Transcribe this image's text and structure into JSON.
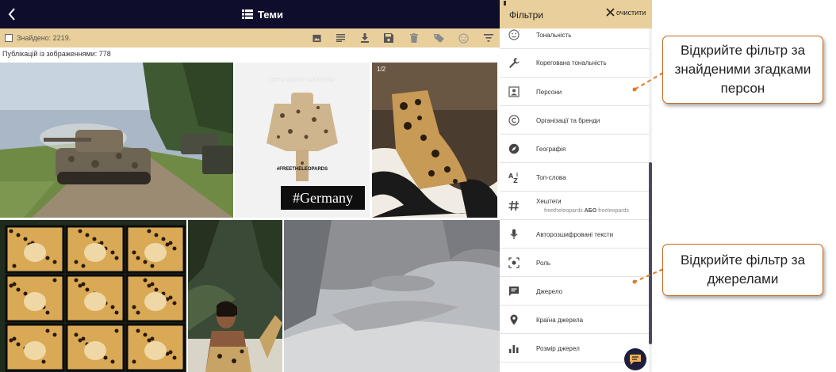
{
  "topbar": {
    "back_icon": "chevron-left-icon",
    "title_icon": "list-icon",
    "title": "Теми"
  },
  "toolbar": {
    "found_label": "Знайдено: 2219.",
    "icons": [
      "image-icon",
      "text-lines-icon",
      "download-icon",
      "save-icon",
      "trash-icon",
      "tag-icon",
      "emoji-icon",
      "filter-icon"
    ]
  },
  "publications_label": "Публікацій із зображеннями: 778",
  "tiles": [
    {
      "name": "tile-tank",
      "badge": ""
    },
    {
      "name": "tile-leopards-poster",
      "caption": "LET'S BRING LEOPARDS",
      "hashtag": "#FREETHELEOPARDS",
      "stamp": "#Germany"
    },
    {
      "name": "tile-leopard-boot",
      "badge": "1/2"
    },
    {
      "name": "tile-leopard-grid"
    },
    {
      "name": "tile-model"
    },
    {
      "name": "tile-snow"
    }
  ],
  "panel": {
    "title": "Фільтри",
    "clear_label": "очистити",
    "items": [
      {
        "icon": "emoji-icon",
        "label": "Тональність",
        "sub": ""
      },
      {
        "icon": "wrench-icon",
        "label": "Корегована тональність",
        "sub": ""
      },
      {
        "icon": "person-icon",
        "label": "Персони",
        "sub": ""
      },
      {
        "icon": "copyright-icon",
        "label": "Організації та бренди",
        "sub": ""
      },
      {
        "icon": "compass-icon",
        "label": "Географія",
        "sub": ""
      },
      {
        "icon": "sort-az-icon",
        "label": "Топ-слова",
        "sub": ""
      },
      {
        "icon": "hashtag-icon",
        "label": "Хештеги",
        "sub_a": "freetheleopards",
        "sub_op": "АБО",
        "sub_b": "freeleopards"
      },
      {
        "icon": "microphone-icon",
        "label": "Авторозшифровані тексти",
        "sub": ""
      },
      {
        "icon": "role-icon",
        "label": "Роль",
        "sub": ""
      },
      {
        "icon": "source-icon",
        "label": "Джерело",
        "sub": ""
      },
      {
        "icon": "location-pin-icon",
        "label": "Країна джерела",
        "sub": ""
      },
      {
        "icon": "bar-chart-icon",
        "label": "Розмір джерел",
        "sub": ""
      }
    ]
  },
  "callouts": [
    {
      "text": "Відкрийте фільтр за знайденими згадками персон"
    },
    {
      "text": "Відкрийте фільтр за джерелами"
    }
  ],
  "colors": {
    "topbar": "#0e0e2c",
    "toolbar": "#e9cf9b",
    "callout_border": "#c96b23",
    "connector": "#e07b2a"
  }
}
